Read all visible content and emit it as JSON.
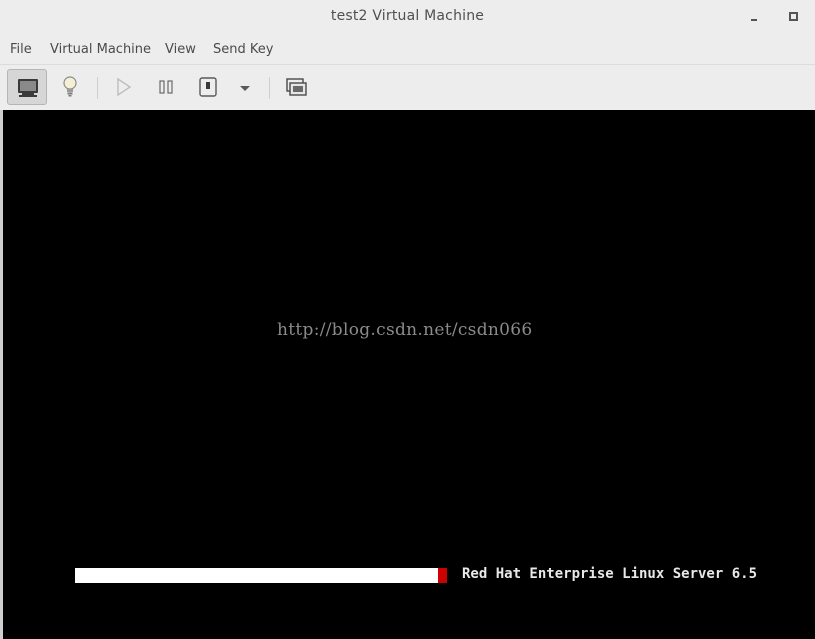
{
  "window": {
    "title": "test2 Virtual Machine",
    "minimize_icon": "minimize-icon",
    "maximize_icon": "maximize-icon"
  },
  "menubar": {
    "items": [
      {
        "label": "File"
      },
      {
        "label": "Virtual Machine"
      },
      {
        "label": "View"
      },
      {
        "label": "Send Key"
      }
    ]
  },
  "toolbar": {
    "buttons": [
      {
        "icon": "console-monitor-icon",
        "active": true
      },
      {
        "icon": "lightbulb-details-icon",
        "active": false
      },
      {
        "icon": "play-icon",
        "active": false,
        "enabled": false
      },
      {
        "icon": "pause-icon",
        "active": false
      },
      {
        "icon": "power-icon",
        "active": false
      },
      {
        "icon": "dropdown-arrow-icon",
        "active": false
      },
      {
        "icon": "snapshots-icon",
        "active": false
      }
    ]
  },
  "console": {
    "watermark": "http://blog.csdn.net/csdn066",
    "boot": {
      "label": "Red Hat Enterprise Linux Server 6.5",
      "progress_fraction": 0.98
    },
    "colors": {
      "background": "#000000",
      "bar_fill": "#ffffff",
      "bar_head": "#cc0000"
    }
  }
}
